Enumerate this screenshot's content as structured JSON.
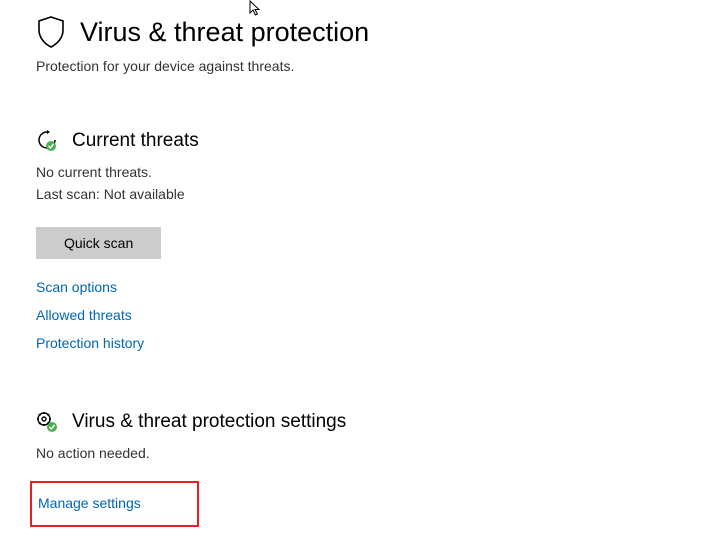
{
  "header": {
    "title": "Virus & threat protection",
    "subtitle": "Protection for your device against threats."
  },
  "currentThreats": {
    "title": "Current threats",
    "statusLine1": "No current threats.",
    "statusLine2": "Last scan: Not available",
    "quickScanLabel": "Quick scan",
    "links": {
      "scanOptions": "Scan options",
      "allowedThreats": "Allowed threats",
      "protectionHistory": "Protection history"
    }
  },
  "settingsSection": {
    "title": "Virus & threat protection settings",
    "status": "No action needed.",
    "manageLink": "Manage settings"
  }
}
